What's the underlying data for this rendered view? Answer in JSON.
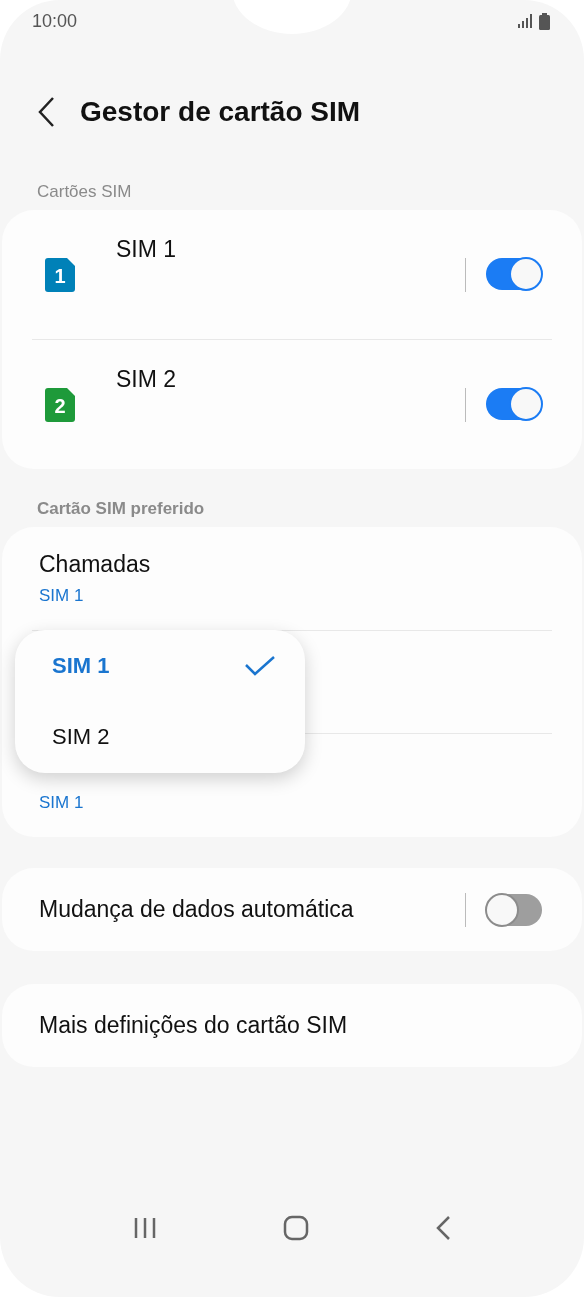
{
  "status_bar": {
    "time": "10:00"
  },
  "header": {
    "title": "Gestor de cartão SIM"
  },
  "sim_section": {
    "title": "Cartões SIM",
    "cards": [
      {
        "name": "SIM 1",
        "badge": "1",
        "color": "#0081b8",
        "on": true
      },
      {
        "name": "SIM 2",
        "badge": "2",
        "color": "#1e9a3a",
        "on": true
      }
    ]
  },
  "preferred_section": {
    "title": "Cartão SIM preferido",
    "rows": [
      {
        "label": "Chamadas",
        "value": "SIM 1"
      },
      {
        "value": "SIM 1"
      }
    ]
  },
  "popup": {
    "options": [
      {
        "label": "SIM 1",
        "selected": true
      },
      {
        "label": "SIM 2",
        "selected": false
      }
    ]
  },
  "auto_switch": {
    "label": "Mudança de dados automática",
    "on": false
  },
  "more": {
    "label": "Mais definições do cartão SIM"
  }
}
